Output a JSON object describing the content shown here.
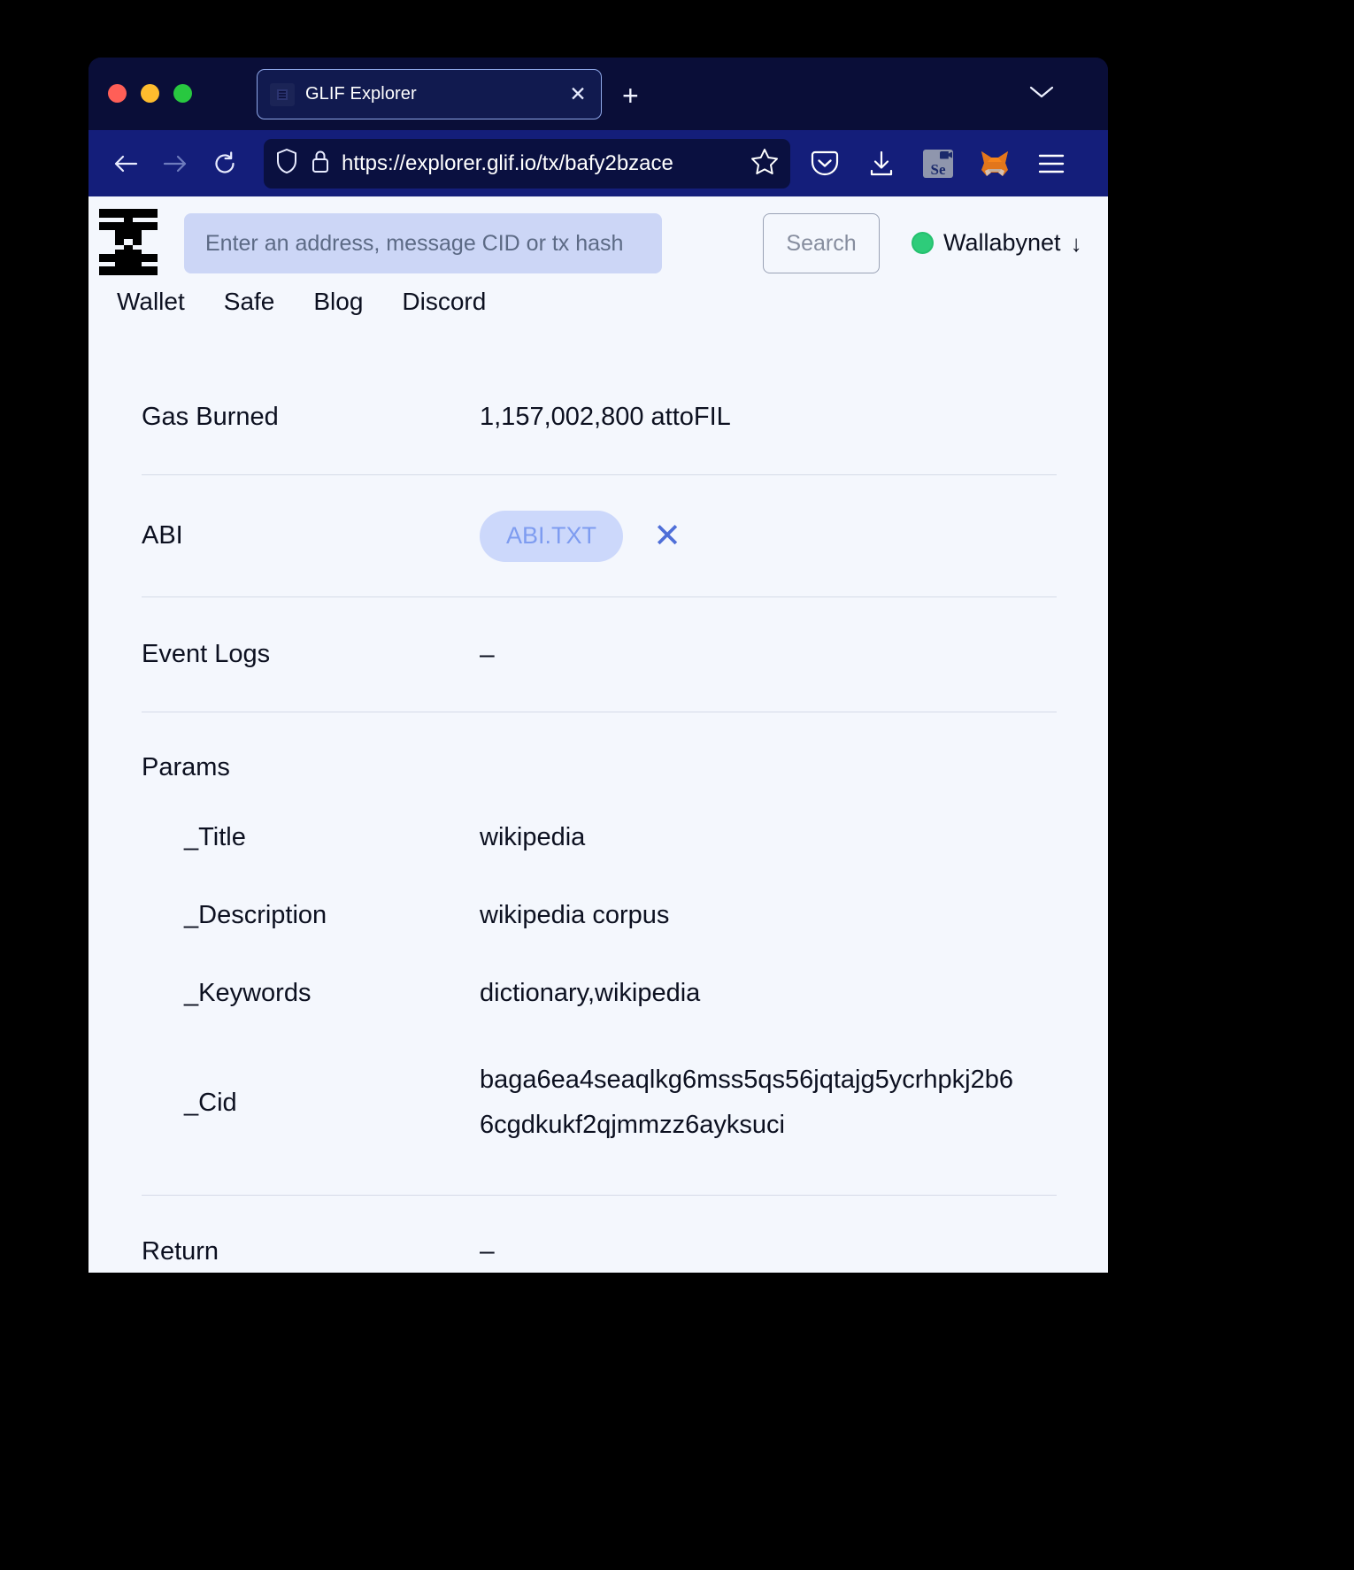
{
  "browser": {
    "tab": {
      "title": "GLIF Explorer",
      "favicon_icon": "glif-favicon",
      "close_icon": "close-icon"
    },
    "new_tab_label": "+",
    "tabs_menu_icon": "chevron-down-icon",
    "nav": {
      "back_icon": "back-arrow-icon",
      "forward_icon": "forward-arrow-icon",
      "reload_icon": "reload-icon"
    },
    "url": {
      "shield_icon": "shield-icon",
      "lock_icon": "lock-icon",
      "value": "https://explorer.glif.io/tx/bafy2bzace",
      "bookmark_icon": "star-icon"
    },
    "toolbar": {
      "pocket_icon": "pocket-icon",
      "downloads_icon": "download-icon",
      "extension_label": "Se",
      "extension_icon": "screen-recorder-icon",
      "wallet_icon": "metamask-fox-icon",
      "menu_icon": "hamburger-menu-icon"
    }
  },
  "site": {
    "logo_icon": "glif-logo",
    "search": {
      "placeholder": "Enter an address, message CID or tx hash",
      "value": "",
      "button_label": "Search"
    },
    "network": {
      "name": "Wallabynet",
      "status_icon": "green-status-dot",
      "arrow": "↓"
    },
    "nav_links": [
      {
        "label": "Wallet"
      },
      {
        "label": "Safe"
      },
      {
        "label": "Blog"
      },
      {
        "label": "Discord"
      }
    ]
  },
  "transaction": {
    "gas_burned": {
      "label": "Gas Burned",
      "value": "1,157,002,800 attoFIL"
    },
    "abi": {
      "label": "ABI",
      "pill_label": "ABI.TXT",
      "remove_icon": "close-x-icon"
    },
    "event_logs": {
      "label": "Event Logs",
      "value": "–"
    },
    "params": {
      "label": "Params",
      "items": [
        {
          "key": "_Title",
          "value": "wikipedia"
        },
        {
          "key": "_Description",
          "value": "wikipedia corpus"
        },
        {
          "key": "_Keywords",
          "value": "dictionary,wikipedia"
        },
        {
          "key": "_Cid",
          "value": "baga6ea4seaqlkg6mss5qs56jqtajg5ycrhpkj2b66cgdkukf2qjmmzz6ayksuci"
        }
      ]
    },
    "return": {
      "label": "Return",
      "value": "–"
    }
  },
  "colors": {
    "chrome_bg": "#0a0e38",
    "navbar_bg": "#141e7a",
    "page_bg": "#f4f7fd",
    "search_bg": "#ccd6f6",
    "pill_bg": "#ccd8fb",
    "pill_text": "#7e9cf0",
    "status_green": "#2ecc7a"
  }
}
